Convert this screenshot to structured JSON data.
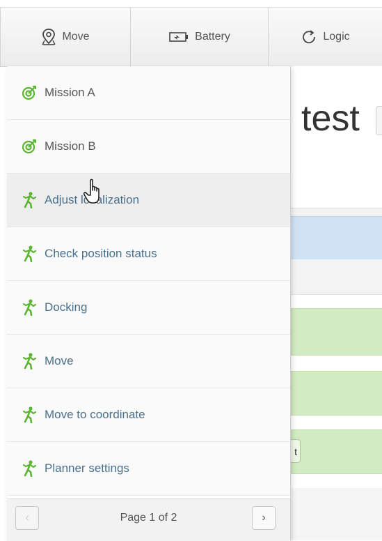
{
  "toolbar": {
    "move_label": "Move",
    "battery_label": "Battery",
    "logic_label": "Logic"
  },
  "background": {
    "page_title": "test",
    "row_button_text": "t"
  },
  "dropdown": {
    "items": [
      {
        "label": "Mission A",
        "icon": "target-icon",
        "kind": "mission"
      },
      {
        "label": "Mission B",
        "icon": "target-icon",
        "kind": "mission"
      },
      {
        "label": "Adjust localization",
        "icon": "walking-person-icon",
        "kind": "action"
      },
      {
        "label": "Check position status",
        "icon": "walking-person-icon",
        "kind": "action"
      },
      {
        "label": "Docking",
        "icon": "walking-person-icon",
        "kind": "action"
      },
      {
        "label": "Move",
        "icon": "walking-person-icon",
        "kind": "action"
      },
      {
        "label": "Move to coordinate",
        "icon": "walking-person-icon",
        "kind": "action"
      },
      {
        "label": "Planner settings",
        "icon": "walking-person-icon",
        "kind": "action"
      }
    ],
    "pager": {
      "label": "Page 1 of 2",
      "prev": "‹",
      "next": "›"
    }
  },
  "colors": {
    "icon_green": "#5cb531",
    "link_blue": "#4a6f8a"
  }
}
